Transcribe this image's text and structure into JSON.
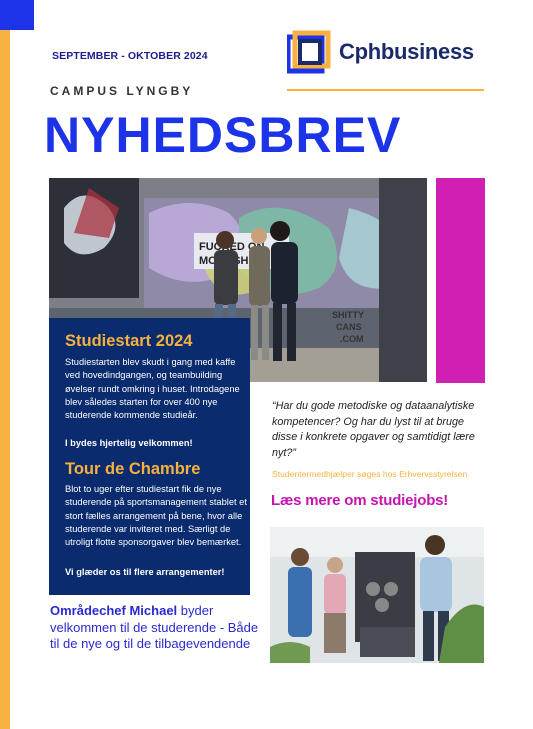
{
  "header": {
    "date": "SEPTEMBER - OKTOBER 2024",
    "logo_text": "Cphbusiness",
    "campus": "CAMPUS LYNGBY",
    "title": "NYHEDSBREV"
  },
  "studiestart": {
    "heading": "Studiestart 2024",
    "body": "Studiestarten blev skudt i gang med kaffe ved hovedindgangen, og teambuilding øvelser rundt omkring i huset. Introdagene blev således starten for over 400 nye studerende kommende studieår.",
    "closing": "I bydes hjertelig velkommen!"
  },
  "tour": {
    "heading": "Tour de Chambre",
    "body": "Blot to uger efter studiestart fik de nye studerende på sportsmanagement stablet et stort fælles arrangement på bene, hvor alle studerende var inviteret med. Særligt de utroligt flotte sponsorgaver blev bemærket.",
    "closing": "Vi glæder os til flere arrangementer!"
  },
  "jobs": {
    "quote": "“Har du gode metodiske og dataanalytiske kompetencer? Og har du lyst til at bruge disse i konkrete opgaver og samtidigt lære nyt?”",
    "caption": "Studentermedhjælper søges hos Erhvervsstyrelsen",
    "read_more": "Læs mere om studiejobs!"
  },
  "caption": {
    "name": "Områdechef Michael",
    "rest": " byder velkommen til de studerende - Både til de nye og til de tilbagevendende"
  },
  "hero_graffiti": [
    "FUCKED ON",
    "MOONSHINE",
    "SHITTY",
    "CANS",
    ".COM"
  ],
  "colors": {
    "accent_blue": "#1d33e8",
    "orange": "#f6b13f",
    "magenta": "#d01fb3",
    "navy": "#0a2b6d",
    "logo_navy": "#1b2a6b"
  }
}
